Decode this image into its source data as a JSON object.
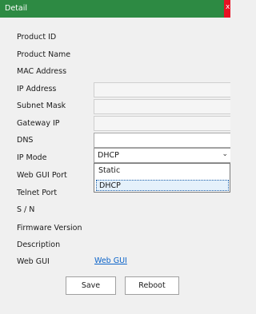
{
  "window": {
    "title": "Detail",
    "close_glyph": "x"
  },
  "labels": {
    "product_id": "Product ID",
    "product_name": "Product Name",
    "mac_address": "MAC Address",
    "ip_address": "IP Address",
    "subnet_mask": "Subnet Mask",
    "gateway_ip": "Gateway IP",
    "dns": "DNS",
    "ip_mode": "IP Mode",
    "web_gui_port": "Web GUI Port",
    "telnet_port": "Telnet Port",
    "sn": "S / N",
    "firmware_version": "Firmware Version",
    "description": "Description",
    "web_gui": "Web GUI"
  },
  "ip_mode": {
    "selected": "DHCP",
    "options": [
      "Static",
      "DHCP"
    ]
  },
  "web_gui_link": "Web GUI",
  "buttons": {
    "save": "Save",
    "reboot": "Reboot"
  }
}
